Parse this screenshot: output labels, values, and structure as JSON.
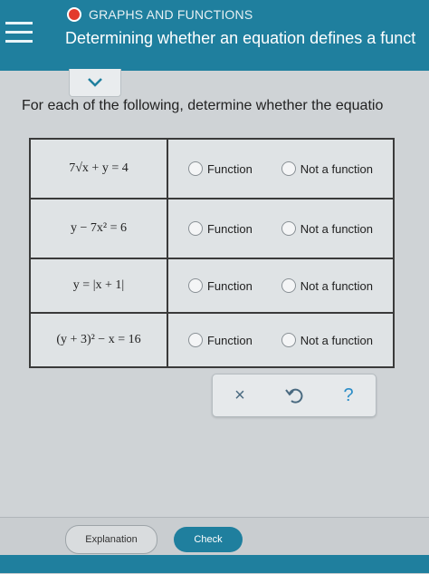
{
  "header": {
    "topic": "GRAPHS AND FUNCTIONS",
    "title": "Determining whether an equation defines a funct",
    "status_color": "#e33a2c",
    "menu_icon": "hamburger-menu-icon"
  },
  "main": {
    "collapse_icon": "chevron-down-icon",
    "instructions": "For each of the following, determine whether the equatio",
    "rows": [
      {
        "equation": "7√x + y = 4",
        "option_function": "Function",
        "option_not": "Not a function"
      },
      {
        "equation": "y − 7x² = 6",
        "option_function": "Function",
        "option_not": "Not a function"
      },
      {
        "equation": "y = |x + 1|",
        "option_function": "Function",
        "option_not": "Not a function"
      },
      {
        "equation": "(y + 3)² − x = 16",
        "option_function": "Function",
        "option_not": "Not a function"
      }
    ]
  },
  "toolbar": {
    "clear_label": "×",
    "undo_icon": "undo-icon",
    "help_label": "?"
  },
  "footer": {
    "explanation_label": "Explanation",
    "check_label": "Check"
  },
  "colors": {
    "brand": "#1f7f9e",
    "help": "#2a8cc7"
  }
}
